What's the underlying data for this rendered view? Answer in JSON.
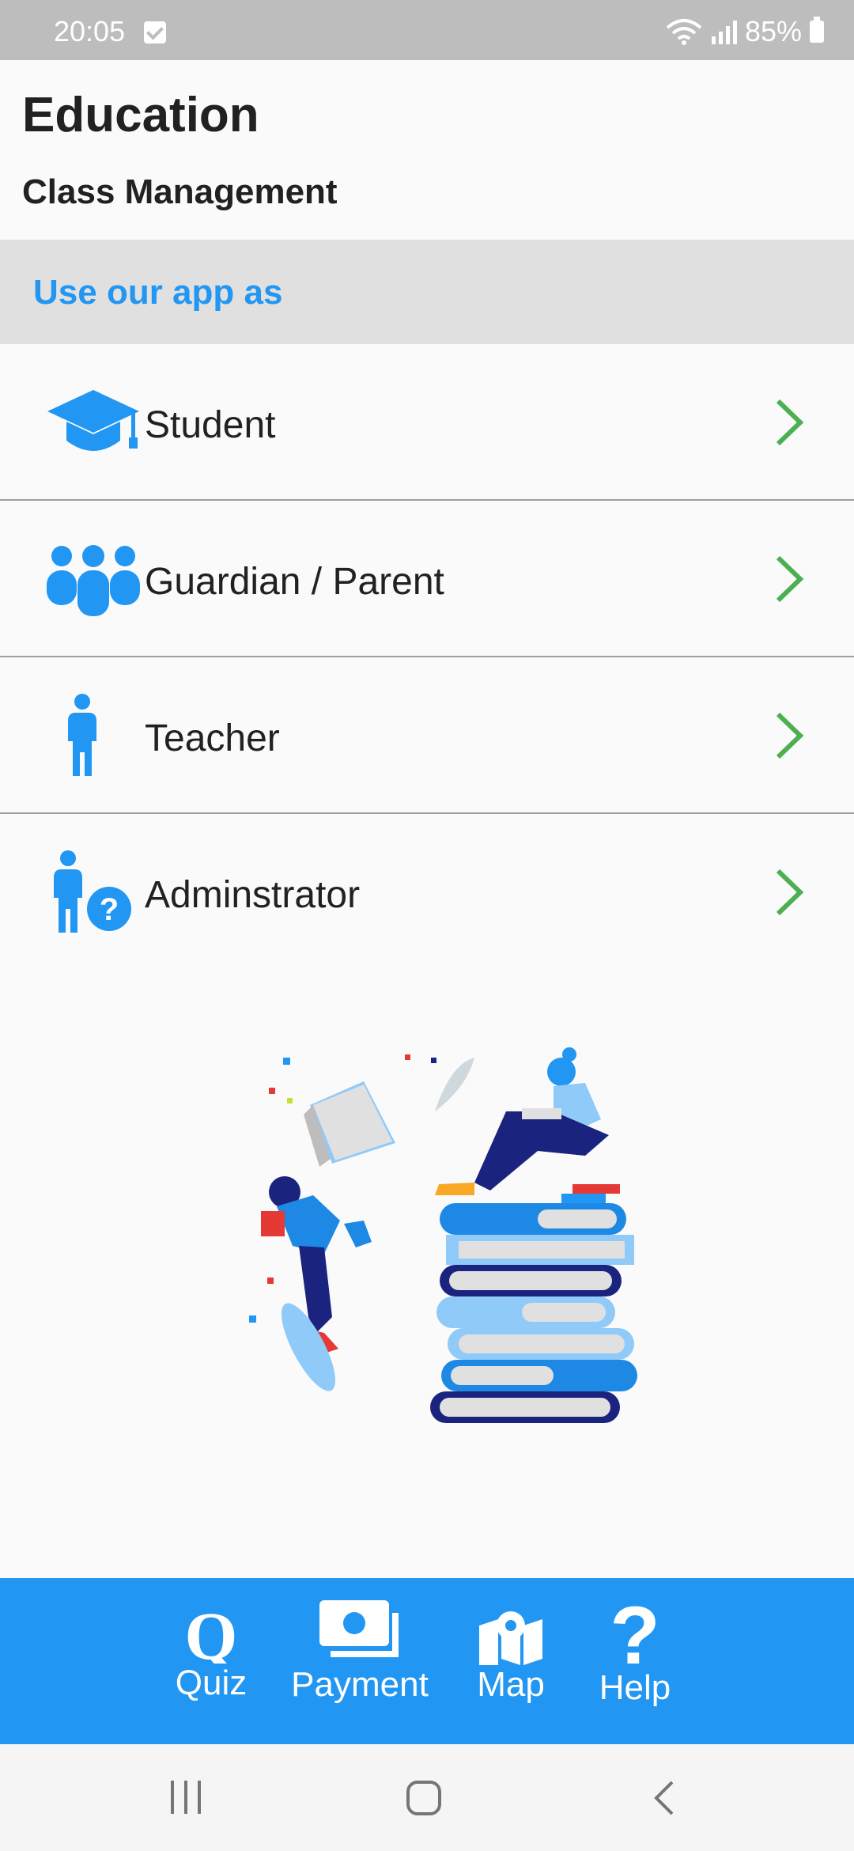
{
  "status": {
    "time": "20:05",
    "battery": "85%"
  },
  "header": {
    "title": "Education",
    "subtitle": "Class Management"
  },
  "section": {
    "label": "Use our app as"
  },
  "roles": [
    {
      "label": "Student",
      "icon": "graduation-cap-icon"
    },
    {
      "label": "Guardian / Parent",
      "icon": "family-icon"
    },
    {
      "label": "Teacher",
      "icon": "person-icon"
    },
    {
      "label": "Adminstrator",
      "icon": "person-question-icon"
    }
  ],
  "nav": [
    {
      "label": "Quiz",
      "icon": "quiz-icon"
    },
    {
      "label": "Payment",
      "icon": "payment-icon"
    },
    {
      "label": "Map",
      "icon": "map-icon"
    },
    {
      "label": "Help",
      "icon": "help-icon"
    }
  ],
  "colors": {
    "accent": "#2196f3",
    "chevron": "#4caf50",
    "section_bg": "#e0e0e0",
    "status_bg": "#bdbdbd"
  }
}
